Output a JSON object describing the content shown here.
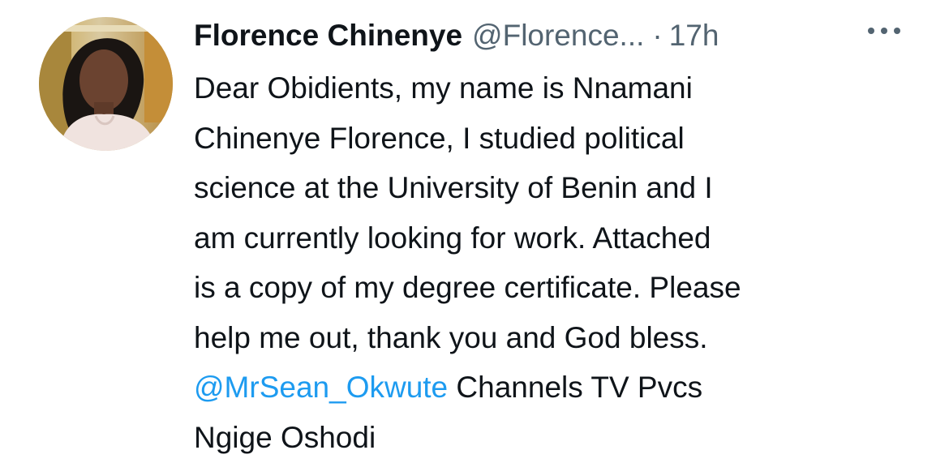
{
  "tweet": {
    "author": {
      "display_name": "Florence Chinenye",
      "handle": "@Florence...",
      "avatar_icon": "profile-photo"
    },
    "separator": "·",
    "time": "17h",
    "more_icon": "more-horizontal-icon",
    "text_lines": [
      "Dear Obidients, my name is Nnamani",
      "Chinenye Florence, I studied political",
      "science at the University of Benin and I",
      "am currently looking for work. Attached",
      "is a copy of my degree certificate. Please",
      "help me out, thank you and God bless."
    ],
    "mention": "@MrSean_Okwute",
    "after_mention": " Channels TV Pvcs",
    "last_line": "Ngige Oshodi"
  },
  "colors": {
    "text": "#0f1419",
    "secondary": "#536471",
    "link": "#1d9bf0"
  }
}
